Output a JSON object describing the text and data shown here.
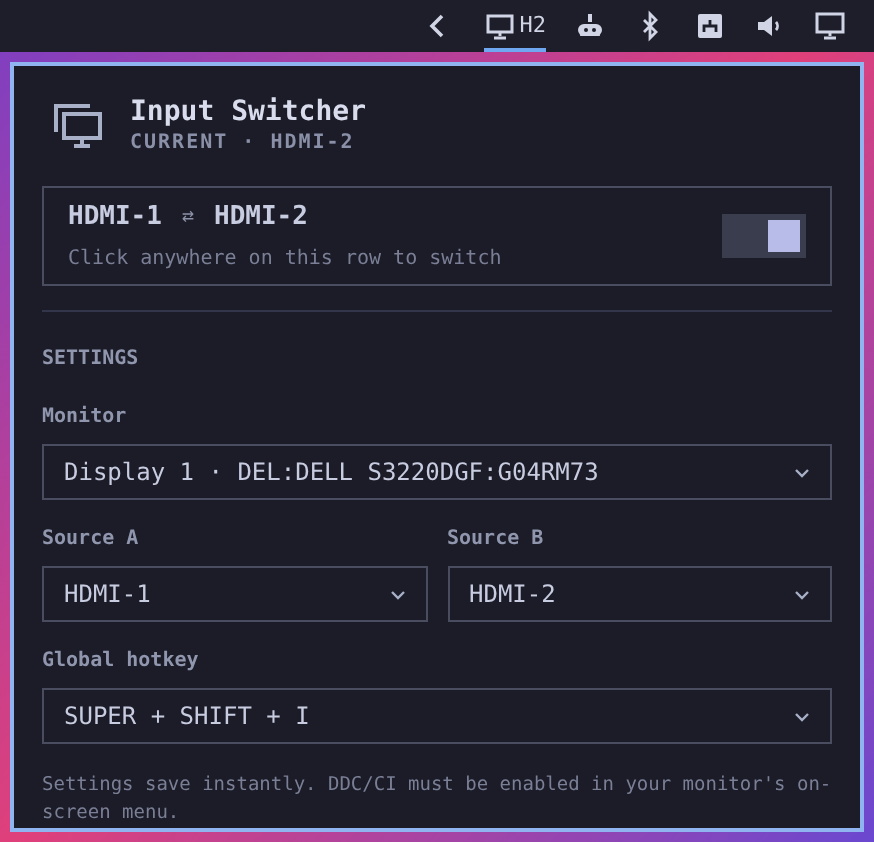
{
  "tray": [
    {
      "kind": "back",
      "selected": false
    },
    {
      "kind": "monitor",
      "label": "H2",
      "selected": true
    },
    {
      "kind": "robot",
      "selected": false
    },
    {
      "kind": "bluetooth",
      "selected": false
    },
    {
      "kind": "network",
      "selected": false
    },
    {
      "kind": "volume",
      "selected": false
    },
    {
      "kind": "display",
      "selected": false
    }
  ],
  "header": {
    "title": "Input Switcher",
    "subtitle": "CURRENT · HDMI-2"
  },
  "switch_row": {
    "source_a": "HDMI-1",
    "swap": "⇄",
    "source_b": "HDMI-2",
    "hint": "Click anywhere on this row to switch",
    "on": true
  },
  "settings": {
    "heading": "SETTINGS",
    "monitor": {
      "label": "Monitor",
      "value": "Display 1 · DEL:DELL S3220DGF:G04RM73"
    },
    "source_a": {
      "label": "Source A",
      "value": "HDMI-1"
    },
    "source_b": {
      "label": "Source B",
      "value": "HDMI-2"
    },
    "hotkey": {
      "label": "Global hotkey",
      "value": "SUPER + SHIFT + I"
    },
    "note": "Settings save instantly. DDC/CI must be enabled in your monitor's on-screen menu."
  }
}
